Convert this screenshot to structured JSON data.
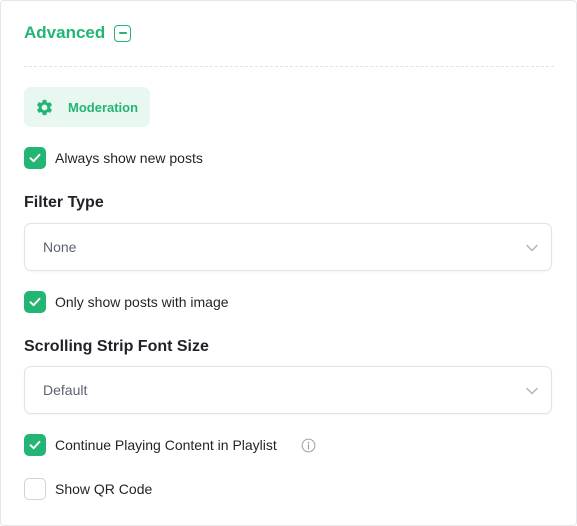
{
  "header": {
    "title": "Advanced"
  },
  "tab": {
    "label": "Moderation"
  },
  "options": {
    "always_show_new_posts": {
      "label": "Always show new posts",
      "checked": true
    },
    "only_show_posts_with_image": {
      "label": "Only show posts with image",
      "checked": true
    },
    "continue_playing": {
      "label": "Continue Playing Content in Playlist",
      "checked": true
    },
    "show_qr_code": {
      "label": "Show QR Code",
      "checked": false
    }
  },
  "filter_type": {
    "title": "Filter Type",
    "value": "None"
  },
  "font_size": {
    "title": "Scrolling Strip Font Size",
    "value": "Default"
  },
  "icons": {
    "collapse": "minus-square-icon",
    "tab": "gear-icon",
    "select": "chevron-down-icon",
    "info": "info-circle-icon",
    "checkbox": "checkmark-icon"
  },
  "colors": {
    "accent": "#22b573",
    "accent_bg": "#e8f7f0",
    "border": "#dfe3e7",
    "text": "#1f2328",
    "muted": "#5b6470"
  }
}
